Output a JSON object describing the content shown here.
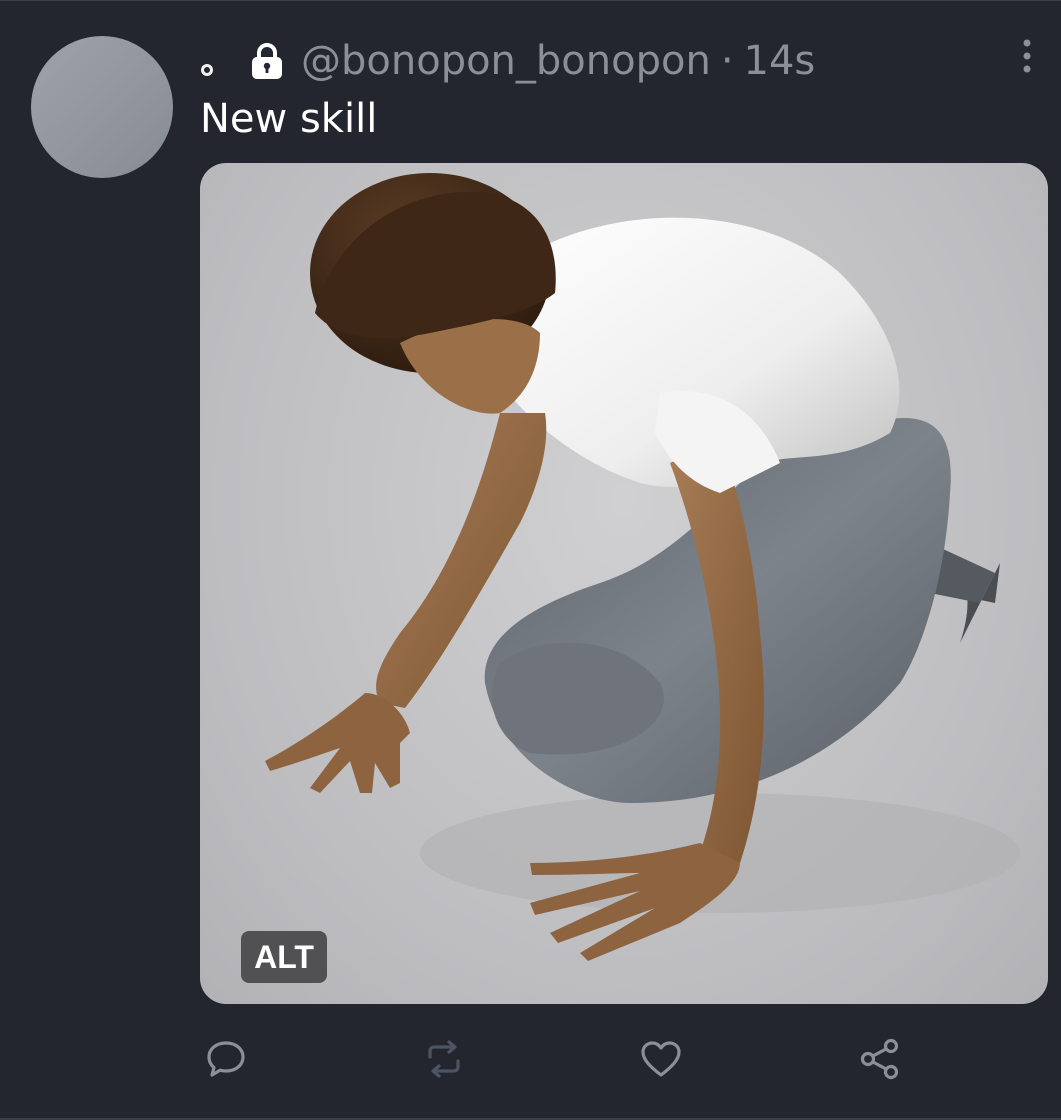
{
  "post": {
    "handle": "@bonopon_bonopon",
    "separator": "·",
    "timestamp": "14s",
    "text": "New skill",
    "media": {
      "alt_badge": "ALT"
    }
  },
  "icons": {
    "lock": "lock-icon",
    "more": "more-vertical-icon",
    "reply": "reply-icon",
    "repost": "repost-icon",
    "like": "heart-icon",
    "share": "share-icon"
  },
  "colors": {
    "background": "#23262f",
    "text": "#ffffff",
    "muted": "#8b8f99",
    "avatar": "#979ba4"
  }
}
